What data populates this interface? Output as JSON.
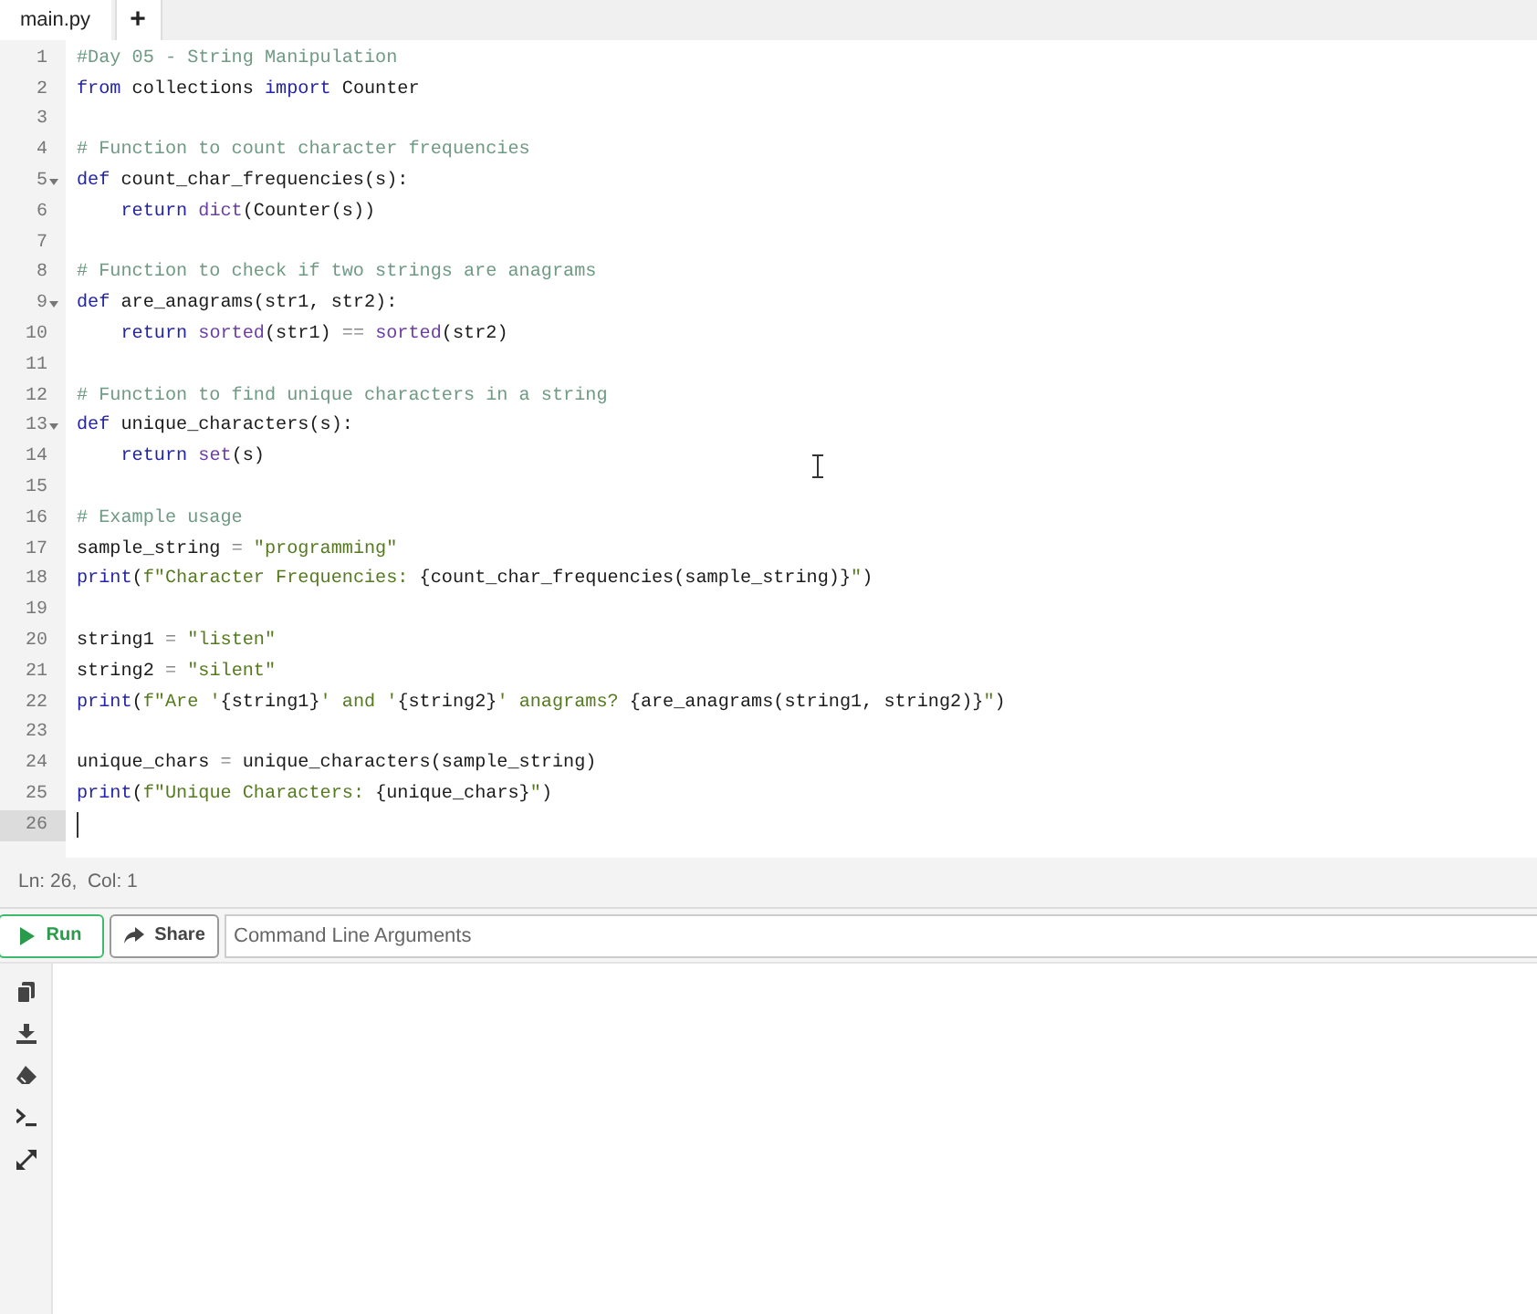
{
  "tabs": [
    {
      "label": "main.py",
      "selected": true
    }
  ],
  "add_tab": "+",
  "code_lines": [
    {
      "number": "1",
      "foldable": false,
      "current": false,
      "tokens": [
        {
          "kind": "comment",
          "text": "#Day 05 - String Manipulation"
        }
      ]
    },
    {
      "number": "2",
      "foldable": false,
      "current": false,
      "tokens": [
        {
          "kind": "keyword",
          "text": "from"
        },
        {
          "kind": "plain",
          "text": " collections "
        },
        {
          "kind": "keyword",
          "text": "import"
        },
        {
          "kind": "plain",
          "text": " Counter"
        }
      ]
    },
    {
      "number": "3",
      "foldable": false,
      "current": false
    },
    {
      "number": "4",
      "foldable": false,
      "current": false,
      "tokens": [
        {
          "kind": "comment",
          "text": "# Function to count character frequencies"
        }
      ]
    },
    {
      "number": "5",
      "foldable": true,
      "current": false,
      "tokens": [
        {
          "kind": "keyword",
          "text": "def"
        },
        {
          "kind": "plain",
          "text": " count_char_frequencies(s):"
        }
      ]
    },
    {
      "number": "6",
      "foldable": false,
      "current": false,
      "tokens": [
        {
          "kind": "keyword",
          "text": "    return"
        },
        {
          "kind": "builtin",
          "text": " dict"
        },
        {
          "kind": "plain",
          "text": "(Counter(s))"
        }
      ]
    },
    {
      "number": "7",
      "foldable": false,
      "current": false
    },
    {
      "number": "8",
      "foldable": false,
      "current": false,
      "tokens": [
        {
          "kind": "comment",
          "text": "# Function to check if two strings are anagrams"
        }
      ]
    },
    {
      "number": "9",
      "foldable": true,
      "current": false,
      "tokens": [
        {
          "kind": "keyword",
          "text": "def"
        },
        {
          "kind": "plain",
          "text": " are_anagrams(str1, str2):"
        }
      ]
    },
    {
      "number": "10",
      "foldable": false,
      "current": false,
      "tokens": [
        {
          "kind": "keyword",
          "text": "    return"
        },
        {
          "kind": "builtin",
          "text": " sorted"
        },
        {
          "kind": "plain",
          "text": "(str1) "
        },
        {
          "kind": "operator",
          "text": "=="
        },
        {
          "kind": "builtin",
          "text": " sorted"
        },
        {
          "kind": "plain",
          "text": "(str2)"
        }
      ]
    },
    {
      "number": "11",
      "foldable": false,
      "current": false
    },
    {
      "number": "12",
      "foldable": false,
      "current": false,
      "tokens": [
        {
          "kind": "comment",
          "text": "# Function to find unique characters in a string"
        }
      ]
    },
    {
      "number": "13",
      "foldable": true,
      "current": false,
      "tokens": [
        {
          "kind": "keyword",
          "text": "def"
        },
        {
          "kind": "plain",
          "text": " unique_characters(s):"
        }
      ]
    },
    {
      "number": "14",
      "foldable": false,
      "current": false,
      "tokens": [
        {
          "kind": "keyword",
          "text": "    return"
        },
        {
          "kind": "builtin",
          "text": " set"
        },
        {
          "kind": "plain",
          "text": "(s)"
        }
      ]
    },
    {
      "number": "15",
      "foldable": false,
      "current": false
    },
    {
      "number": "16",
      "foldable": false,
      "current": false,
      "tokens": [
        {
          "kind": "comment",
          "text": "# Example usage"
        }
      ]
    },
    {
      "number": "17",
      "foldable": false,
      "current": false,
      "tokens": [
        {
          "kind": "plain",
          "text": "sample_string "
        },
        {
          "kind": "operator",
          "text": "="
        },
        {
          "kind": "string",
          "text": " \"programming\""
        }
      ]
    },
    {
      "number": "18",
      "foldable": false,
      "current": false,
      "tokens": [
        {
          "kind": "keyword",
          "text": "print"
        },
        {
          "kind": "plain",
          "text": "("
        },
        {
          "kind": "string",
          "text": "f\"Character Frequencies: "
        },
        {
          "kind": "plain",
          "text": "{count_char_frequencies(sample_string)}"
        },
        {
          "kind": "string",
          "text": "\""
        },
        {
          "kind": "plain",
          "text": ")"
        }
      ]
    },
    {
      "number": "19",
      "foldable": false,
      "current": false
    },
    {
      "number": "20",
      "foldable": false,
      "current": false,
      "tokens": [
        {
          "kind": "plain",
          "text": "string1 "
        },
        {
          "kind": "operator",
          "text": "="
        },
        {
          "kind": "string",
          "text": " \"listen\""
        }
      ]
    },
    {
      "number": "21",
      "foldable": false,
      "current": false,
      "tokens": [
        {
          "kind": "plain",
          "text": "string2 "
        },
        {
          "kind": "operator",
          "text": "="
        },
        {
          "kind": "string",
          "text": " \"silent\""
        }
      ]
    },
    {
      "number": "22",
      "foldable": false,
      "current": false,
      "tokens": [
        {
          "kind": "keyword",
          "text": "print"
        },
        {
          "kind": "plain",
          "text": "("
        },
        {
          "kind": "string",
          "text": "f\"Are '"
        },
        {
          "kind": "plain",
          "text": "{string1}"
        },
        {
          "kind": "string",
          "text": "' and '"
        },
        {
          "kind": "plain",
          "text": "{string2}"
        },
        {
          "kind": "string",
          "text": "' anagrams? "
        },
        {
          "kind": "plain",
          "text": "{are_anagrams(string1, string2)}"
        },
        {
          "kind": "string",
          "text": "\""
        },
        {
          "kind": "plain",
          "text": ")"
        }
      ]
    },
    {
      "number": "23",
      "foldable": false,
      "current": false
    },
    {
      "number": "24",
      "foldable": false,
      "current": false,
      "tokens": [
        {
          "kind": "plain",
          "text": "unique_chars "
        },
        {
          "kind": "operator",
          "text": "="
        },
        {
          "kind": "plain",
          "text": " unique_characters(sample_string)"
        }
      ]
    },
    {
      "number": "25",
      "foldable": false,
      "current": false,
      "tokens": [
        {
          "kind": "keyword",
          "text": "print"
        },
        {
          "kind": "plain",
          "text": "("
        },
        {
          "kind": "string",
          "text": "f\"Unique Characters: "
        },
        {
          "kind": "plain",
          "text": "{unique_chars}"
        },
        {
          "kind": "string",
          "text": "\""
        },
        {
          "kind": "plain",
          "text": ")"
        }
      ]
    },
    {
      "number": "26",
      "foldable": false,
      "current": true
    }
  ],
  "status_bar": {
    "position": "Ln: 26,  Col: 1"
  },
  "toolbar": {
    "run": "Run",
    "share": "Share",
    "arguments": {
      "placeholder": "Command Line Arguments"
    }
  },
  "output_tools": [
    {
      "kind": "copy"
    },
    {
      "kind": "download"
    },
    {
      "kind": "clear"
    },
    {
      "kind": "terminal"
    },
    {
      "kind": "expand"
    }
  ]
}
